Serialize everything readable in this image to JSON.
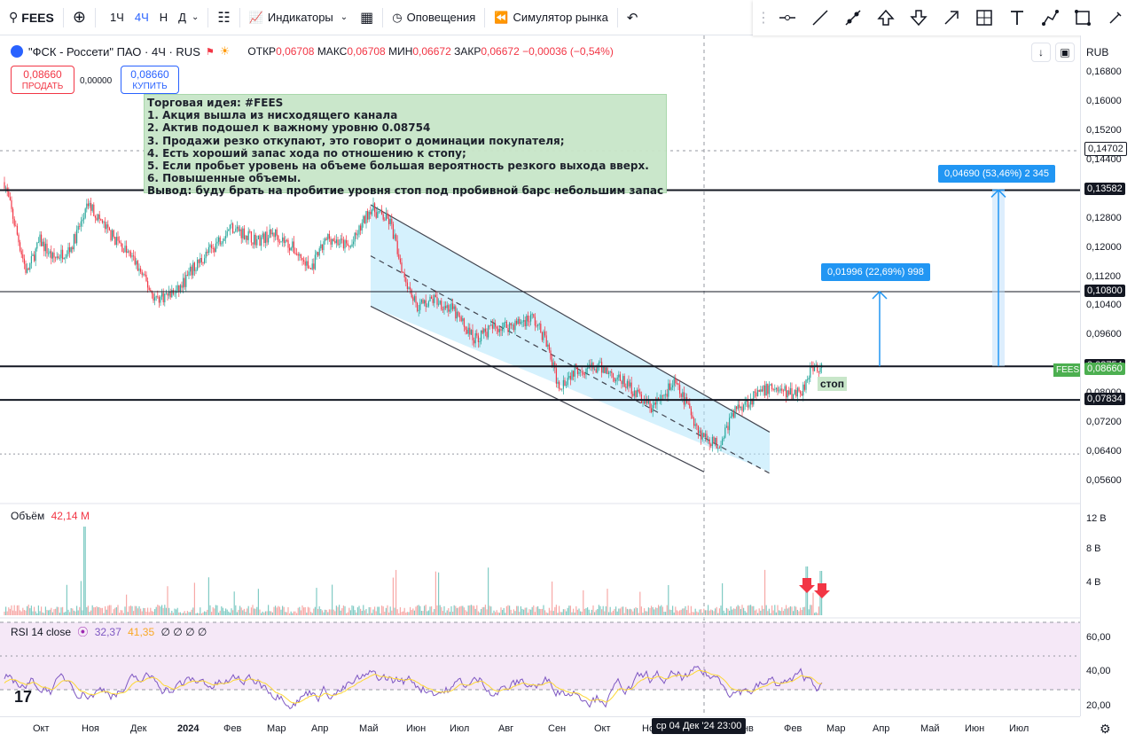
{
  "toolbar": {
    "symbol": "FEES",
    "intervals": [
      "1Ч",
      "4Ч",
      "Н",
      "Д"
    ],
    "active_interval": "4Ч",
    "indicators_label": "Индикаторы",
    "alerts_label": "Оповещения",
    "replay_label": "Симулятор рынка"
  },
  "legend": {
    "title": "\"ФСК - Россети\" ПАО · 4Ч · RUS",
    "open_label": "ОТКР",
    "open": "0,06708",
    "high_label": "МАКС",
    "high": "0,06708",
    "low_label": "МИН",
    "low": "0,06672",
    "close_label": "ЗАКР",
    "close": "0,06672",
    "change": "−0,00036 (−0,54%)"
  },
  "trade": {
    "sell_price": "0,08660",
    "sell_label": "ПРОДАТЬ",
    "spread": "0,00000",
    "buy_price": "0,08660",
    "buy_label": "КУПИТЬ"
  },
  "idea": {
    "lines": [
      "Торговая идея: #FEES",
      "1. Акция вышла из нисходящего канала",
      "2. Актив подошел к важному уровню 0.08754",
      "3. Продажи резко откупают, это говорит о доминации покупателя;",
      "4. Есть хороший запас хода по отношению к стопу;",
      "5. Если пробьет уровень на объеме большая вероятность резкого выхода вверх.",
      "6. Повышенные объемы.",
      "Вывод: буду брать на пробитие уровня стоп под пробивной барс небольшим запасом."
    ]
  },
  "currency": "RUB",
  "price_scale": {
    "labels": [
      "0,16800",
      "0,16000",
      "0,15200",
      "0,14400",
      "0,13600",
      "0,12800",
      "0,12000",
      "0,11200",
      "0,10400",
      "0,09600",
      "0,08800",
      "0,08000",
      "0,07200",
      "0,06400",
      "0,05600"
    ],
    "badges": [
      {
        "price": "0,14702",
        "color": "#ffffff",
        "text_color": "#131722"
      },
      {
        "price": "0,13582",
        "color": "#131722",
        "text_color": "#ffffff"
      },
      {
        "price": "0,10800",
        "color": "#131722",
        "text_color": "#ffffff"
      },
      {
        "price": "0,08754",
        "color": "#131722",
        "text_color": "#ffffff"
      },
      {
        "price": "0,08660",
        "color": "#4caf50",
        "text_color": "#ffffff"
      },
      {
        "price": "0,07834",
        "color": "#131722",
        "text_color": "#ffffff"
      }
    ]
  },
  "levels": [
    "0,13582",
    "0,10800",
    "0,08754",
    "0,07834"
  ],
  "measures": {
    "upper": "0,04690 (53,46%) 2 345",
    "lower": "0,01996 (22,69%) 998"
  },
  "stop_label": "стоп",
  "symbol_tag": "FEES",
  "volume": {
    "label": "Объём",
    "value": "42,14 M",
    "scale": [
      "12 B",
      "8 B",
      "4 B"
    ]
  },
  "rsi": {
    "label": "RSI 14 close",
    "rsi_value": "32,37",
    "ma_value": "41,35",
    "extra": "∅ ∅ ∅ ∅",
    "scale": [
      "60,00",
      "40,00",
      "20,00"
    ]
  },
  "time_axis": {
    "labels": [
      "Окт",
      "Ноя",
      "Дек",
      "2024",
      "Фев",
      "Мар",
      "Апр",
      "Май",
      "Июн",
      "Июл",
      "Авг",
      "Сен",
      "Окт",
      "Ноя",
      "Янв",
      "Фев",
      "Мар",
      "Апр",
      "Май",
      "Июн",
      "Июл"
    ],
    "crosshair": "ср 04 Дек '24   23:00"
  },
  "colors": {
    "up": "#26a69a",
    "down": "#f23645",
    "channel": "#b3e5fc",
    "measure": "#2196f3",
    "accent": "#2962ff"
  }
}
